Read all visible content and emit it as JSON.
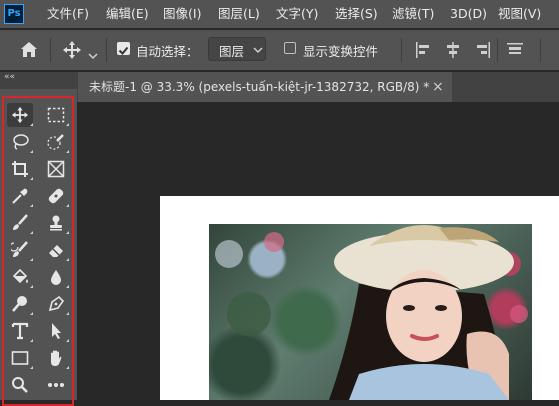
{
  "app": {
    "logo": "Ps"
  },
  "menu": [
    "文件(F)",
    "编辑(E)",
    "图像(I)",
    "图层(L)",
    "文字(Y)",
    "选择(S)",
    "滤镜(T)",
    "3D(D)",
    "视图(V)"
  ],
  "options_bar": {
    "home_icon": "home-icon",
    "move_icon": "move-icon",
    "auto_select_label": "自动选择：",
    "auto_select_checked": true,
    "auto_select_target": "图层",
    "show_transform_label": "显示变换控件",
    "show_transform_checked": false,
    "align_icons": [
      "align-left-icon",
      "align-hcenter-icon",
      "align-right-icon",
      "align-top-icon"
    ]
  },
  "tab": {
    "collapse_glyph": "««",
    "title": "未标题-1 @ 33.3% (pexels-tuấn-kiệt-jr-1382732, RGB/8) *",
    "close": "×"
  },
  "tools": [
    [
      "move-tool",
      "marquee-tool"
    ],
    [
      "lasso-tool",
      "quick-selection-tool"
    ],
    [
      "crop-tool",
      "frame-tool"
    ],
    [
      "eyedropper-tool",
      "healing-brush-tool"
    ],
    [
      "brush-tool",
      "clone-stamp-tool"
    ],
    [
      "history-brush-tool",
      "eraser-tool"
    ],
    [
      "paint-bucket-tool",
      "blur-tool"
    ],
    [
      "dodge-tool",
      "pen-tool"
    ],
    [
      "type-tool",
      "path-selection-tool"
    ],
    [
      "rectangle-tool",
      "hand-tool"
    ],
    [
      "zoom-tool",
      "more-tools"
    ]
  ],
  "colors": {
    "menu_bg": "#535353",
    "canvas_bg": "#282828",
    "highlight": "#d8262d",
    "ps_blue": "#31a8ff"
  }
}
